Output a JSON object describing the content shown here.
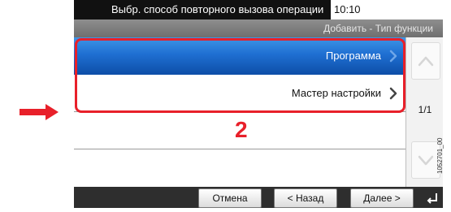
{
  "status_bar": {
    "title": "Выбр. способ повторного вызова операции",
    "time": "10:10"
  },
  "subheader": {
    "breadcrumb": "Добавить - Тип функции"
  },
  "list": {
    "items": [
      {
        "label": "Программа",
        "selected": true
      },
      {
        "label": "Мастер настройки",
        "selected": false
      }
    ]
  },
  "scroll": {
    "page_indicator": "1/1"
  },
  "footer": {
    "cancel": "Отмена",
    "back": "< Назад",
    "next": "Далее >"
  },
  "annotation": {
    "step": "2",
    "ref": "1052701_00"
  },
  "colors": {
    "accent": "#1f6fd2",
    "highlight": "#e8202a"
  }
}
